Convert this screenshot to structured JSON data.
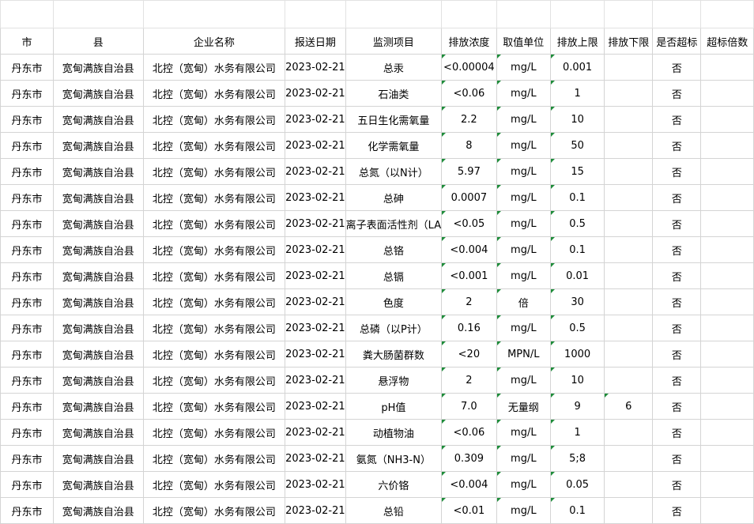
{
  "columns": [
    "市",
    "县",
    "企业名称",
    "报送日期",
    "监测项目",
    "排放浓度",
    "取值单位",
    "排放上限",
    "排放下限",
    "是否超标",
    "超标倍数"
  ],
  "rows": [
    {
      "city": "丹东市",
      "county": "宽甸满族自治县",
      "company": "北控（宽甸）水务有限公司",
      "date": "2023-02-21",
      "item": "总汞",
      "conc": "<0.00004",
      "unit": "mg/L",
      "upper": "0.001",
      "lower": "",
      "exceed": "否",
      "times": ""
    },
    {
      "city": "丹东市",
      "county": "宽甸满族自治县",
      "company": "北控（宽甸）水务有限公司",
      "date": "2023-02-21",
      "item": "石油类",
      "conc": "<0.06",
      "unit": "mg/L",
      "upper": "1",
      "lower": "",
      "exceed": "否",
      "times": ""
    },
    {
      "city": "丹东市",
      "county": "宽甸满族自治县",
      "company": "北控（宽甸）水务有限公司",
      "date": "2023-02-21",
      "item": "五日生化需氧量",
      "conc": "2.2",
      "unit": "mg/L",
      "upper": "10",
      "lower": "",
      "exceed": "否",
      "times": ""
    },
    {
      "city": "丹东市",
      "county": "宽甸满族自治县",
      "company": "北控（宽甸）水务有限公司",
      "date": "2023-02-21",
      "item": "化学需氧量",
      "conc": "8",
      "unit": "mg/L",
      "upper": "50",
      "lower": "",
      "exceed": "否",
      "times": ""
    },
    {
      "city": "丹东市",
      "county": "宽甸满族自治县",
      "company": "北控（宽甸）水务有限公司",
      "date": "2023-02-21",
      "item": "总氮（以N计）",
      "conc": "5.97",
      "unit": "mg/L",
      "upper": "15",
      "lower": "",
      "exceed": "否",
      "times": ""
    },
    {
      "city": "丹东市",
      "county": "宽甸满族自治县",
      "company": "北控（宽甸）水务有限公司",
      "date": "2023-02-21",
      "item": "总砷",
      "conc": "0.0007",
      "unit": "mg/L",
      "upper": "0.1",
      "lower": "",
      "exceed": "否",
      "times": ""
    },
    {
      "city": "丹东市",
      "county": "宽甸满族自治县",
      "company": "北控（宽甸）水务有限公司",
      "date": "2023-02-21",
      "item": "离子表面活性剂（LA",
      "conc": "<0.05",
      "unit": "mg/L",
      "upper": "0.5",
      "lower": "",
      "exceed": "否",
      "times": ""
    },
    {
      "city": "丹东市",
      "county": "宽甸满族自治县",
      "company": "北控（宽甸）水务有限公司",
      "date": "2023-02-21",
      "item": "总铬",
      "conc": "<0.004",
      "unit": "mg/L",
      "upper": "0.1",
      "lower": "",
      "exceed": "否",
      "times": ""
    },
    {
      "city": "丹东市",
      "county": "宽甸满族自治县",
      "company": "北控（宽甸）水务有限公司",
      "date": "2023-02-21",
      "item": "总镉",
      "conc": "<0.001",
      "unit": "mg/L",
      "upper": "0.01",
      "lower": "",
      "exceed": "否",
      "times": ""
    },
    {
      "city": "丹东市",
      "county": "宽甸满族自治县",
      "company": "北控（宽甸）水务有限公司",
      "date": "2023-02-21",
      "item": "色度",
      "conc": "2",
      "unit": "倍",
      "upper": "30",
      "lower": "",
      "exceed": "否",
      "times": ""
    },
    {
      "city": "丹东市",
      "county": "宽甸满族自治县",
      "company": "北控（宽甸）水务有限公司",
      "date": "2023-02-21",
      "item": "总磷（以P计）",
      "conc": "0.16",
      "unit": "mg/L",
      "upper": "0.5",
      "lower": "",
      "exceed": "否",
      "times": ""
    },
    {
      "city": "丹东市",
      "county": "宽甸满族自治县",
      "company": "北控（宽甸）水务有限公司",
      "date": "2023-02-21",
      "item": "粪大肠菌群数",
      "conc": "<20",
      "unit": "MPN/L",
      "upper": "1000",
      "lower": "",
      "exceed": "否",
      "times": ""
    },
    {
      "city": "丹东市",
      "county": "宽甸满族自治县",
      "company": "北控（宽甸）水务有限公司",
      "date": "2023-02-21",
      "item": "悬浮物",
      "conc": "2",
      "unit": "mg/L",
      "upper": "10",
      "lower": "",
      "exceed": "否",
      "times": ""
    },
    {
      "city": "丹东市",
      "county": "宽甸满族自治县",
      "company": "北控（宽甸）水务有限公司",
      "date": "2023-02-21",
      "item": "pH值",
      "conc": "7.0",
      "unit": "无量纲",
      "upper": "9",
      "lower": "6",
      "exceed": "否",
      "times": ""
    },
    {
      "city": "丹东市",
      "county": "宽甸满族自治县",
      "company": "北控（宽甸）水务有限公司",
      "date": "2023-02-21",
      "item": "动植物油",
      "conc": "<0.06",
      "unit": "mg/L",
      "upper": "1",
      "lower": "",
      "exceed": "否",
      "times": ""
    },
    {
      "city": "丹东市",
      "county": "宽甸满族自治县",
      "company": "北控（宽甸）水务有限公司",
      "date": "2023-02-21",
      "item": "氨氮（NH3-N）",
      "conc": "0.309",
      "unit": "mg/L",
      "upper": "5;8",
      "lower": "",
      "exceed": "否",
      "times": ""
    },
    {
      "city": "丹东市",
      "county": "宽甸满族自治县",
      "company": "北控（宽甸）水务有限公司",
      "date": "2023-02-21",
      "item": "六价铬",
      "conc": "<0.004",
      "unit": "mg/L",
      "upper": "0.05",
      "lower": "",
      "exceed": "否",
      "times": ""
    },
    {
      "city": "丹东市",
      "county": "宽甸满族自治县",
      "company": "北控（宽甸）水务有限公司",
      "date": "2023-02-21",
      "item": "总铅",
      "conc": "<0.01",
      "unit": "mg/L",
      "upper": "0.1",
      "lower": "",
      "exceed": "否",
      "times": ""
    }
  ],
  "colors": {
    "gridline": "#d4d4d4",
    "indicator": "#1e8c3a"
  }
}
